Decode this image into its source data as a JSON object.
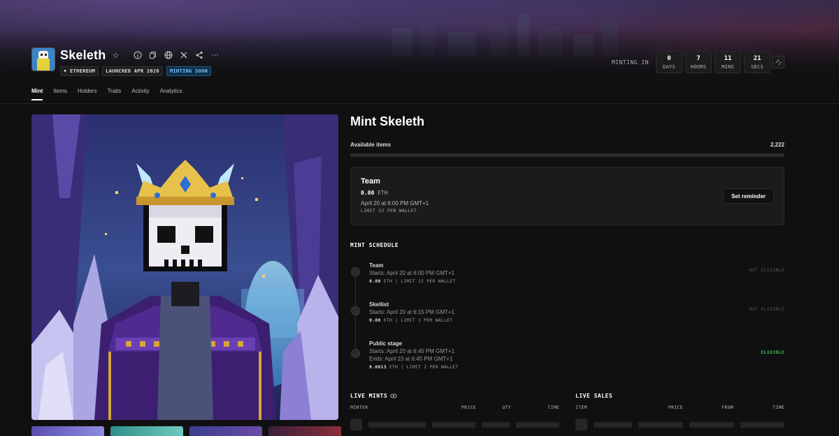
{
  "collection": {
    "name": "Skeleth",
    "badges": [
      "♦ ETHEREUM",
      "LAUNCHED APR 2026",
      "MINTING SOON"
    ]
  },
  "countdown": {
    "label": "MINTING IN",
    "units": [
      {
        "value": "0",
        "label": "DAYS"
      },
      {
        "value": "7",
        "label": "HOURS"
      },
      {
        "value": "11",
        "label": "MINS"
      },
      {
        "value": "21",
        "label": "SECS"
      }
    ]
  },
  "tabs": [
    "Mint",
    "Items",
    "Holders",
    "Traits",
    "Activity",
    "Analytics"
  ],
  "mint": {
    "title": "Mint Skeleth",
    "available_label": "Available items",
    "available_value": "2,222",
    "available_fraction": 0,
    "current_stage": {
      "name": "Team",
      "price": "0.00",
      "unit": "ETH",
      "date": "April 20 at 6:00 PM GMT+1",
      "limit": "LIMIT 22 PER WALLET",
      "button": "Set reminder"
    },
    "schedule_label": "MINT SCHEDULE",
    "schedule": [
      {
        "name": "Team",
        "lines": [
          "Starts: April 20 at 6:00 PM GMT+1"
        ],
        "price": "0.00",
        "meta": "ETH | LIMIT 22 PER WALLET",
        "status": "NOT ELIGIBLE",
        "eligible": false
      },
      {
        "name": "Skellist",
        "lines": [
          "Starts: April 20 at 6:15 PM GMT+1"
        ],
        "price": "0.00",
        "meta": "ETH | LIMIT 1 PER WALLET",
        "status": "NOT ELIGIBLE",
        "eligible": false
      },
      {
        "name": "Public stage",
        "lines": [
          "Starts: April 20 at 6:45 PM GMT+1",
          "Ends: April 23 at 6:45 PM GMT+1"
        ],
        "price": "0.0013",
        "meta": "ETH | LIMIT 2 PER WALLET",
        "status": "ELIGIBLE",
        "eligible": true
      }
    ]
  },
  "live_mints": {
    "title": "LIVE MINTS",
    "columns": [
      "MINTER",
      "PRICE",
      "QTY",
      "TIME"
    ]
  },
  "live_sales": {
    "title": "LIVE SALES",
    "columns": [
      "ITEM",
      "PRICE",
      "FROM",
      "TIME"
    ]
  },
  "colors": {
    "accent_blue": "#7cc4ff",
    "eligible_green": "#3fb950",
    "background": "#101010"
  }
}
